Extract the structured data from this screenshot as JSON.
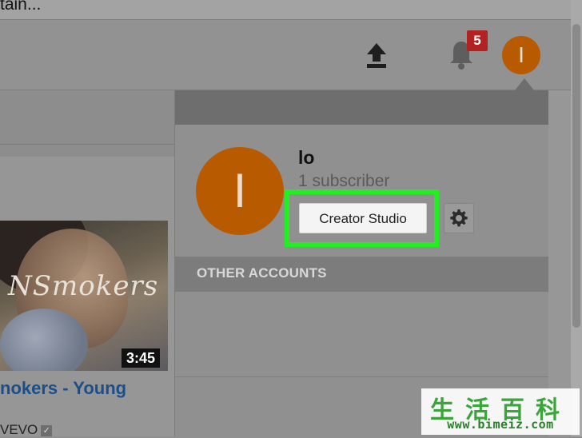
{
  "top_strip": {
    "text": "tain..."
  },
  "header": {
    "upload_icon": "upload-icon",
    "bell_icon": "notifications-bell-icon",
    "notification_count": "5",
    "avatar_initial": "I"
  },
  "video": {
    "thumbnail_text": "NSmokers",
    "duration": "3:45",
    "title": "nokers - Young",
    "channel": "VEVO",
    "verified_icon": "verified-check-icon"
  },
  "account_menu": {
    "avatar_initial": "I",
    "user_name": "lo",
    "subscribers": "1 subscriber",
    "creator_studio_label": "Creator Studio",
    "settings_icon": "gear-icon",
    "other_accounts_label": "OTHER ACCOUNTS"
  },
  "watermark": {
    "chars": "生活百科",
    "url": "www.bimeiz.com"
  },
  "colors": {
    "highlight": "#22ee22",
    "avatar": "#b85a00",
    "badge": "#b22222",
    "video_title": "#1b4f8a"
  }
}
